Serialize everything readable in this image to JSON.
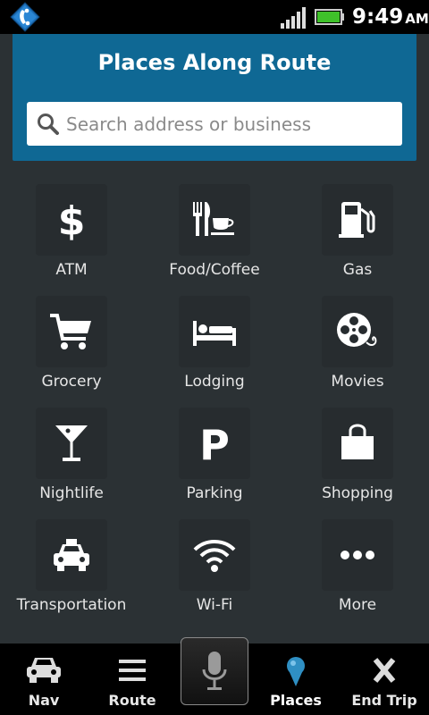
{
  "status_bar": {
    "time": "9:49",
    "ampm": "AM"
  },
  "header": {
    "title": "Places Along Route",
    "search_placeholder": "Search address or business"
  },
  "categories": [
    {
      "label": "ATM",
      "icon": "dollar-icon"
    },
    {
      "label": "Food/Coffee",
      "icon": "fork-knife-cup-icon"
    },
    {
      "label": "Gas",
      "icon": "gas-pump-icon"
    },
    {
      "label": "Grocery",
      "icon": "shopping-cart-icon"
    },
    {
      "label": "Lodging",
      "icon": "bed-icon"
    },
    {
      "label": "Movies",
      "icon": "film-reel-icon"
    },
    {
      "label": "Nightlife",
      "icon": "martini-glass-icon"
    },
    {
      "label": "Parking",
      "icon": "parking-icon"
    },
    {
      "label": "Shopping",
      "icon": "shopping-bag-icon"
    },
    {
      "label": "Transportation",
      "icon": "taxi-icon"
    },
    {
      "label": "Wi-Fi",
      "icon": "wifi-icon"
    },
    {
      "label": "More",
      "icon": "more-dots-icon"
    }
  ],
  "bottom_nav": {
    "nav": "Nav",
    "route": "Route",
    "places": "Places",
    "end_trip": "End Trip"
  },
  "colors": {
    "background": "#2b3134",
    "header": "#0f6894",
    "places_pin": "#2f8fc3"
  }
}
